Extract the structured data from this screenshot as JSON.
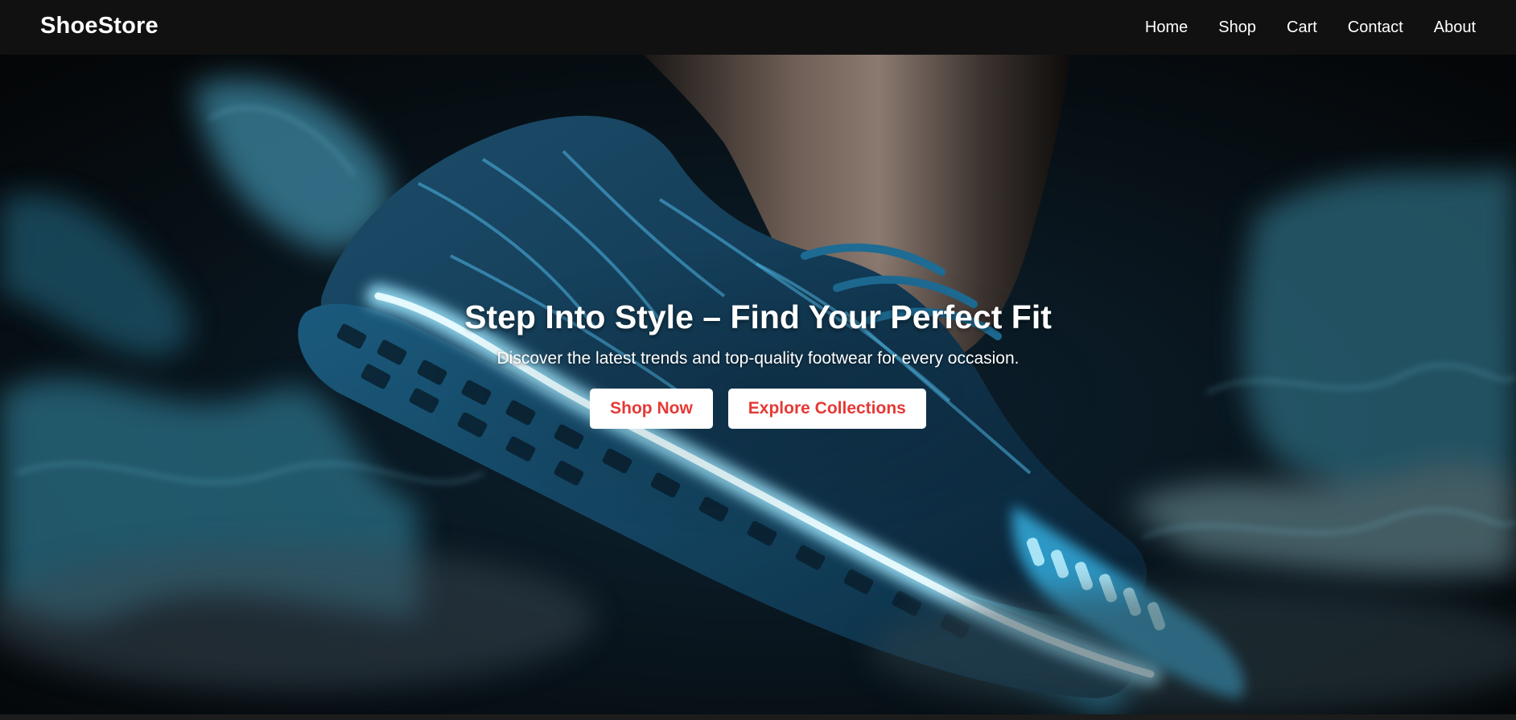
{
  "brand": {
    "name": "ShoeStore"
  },
  "nav": {
    "items": [
      {
        "label": "Home"
      },
      {
        "label": "Shop"
      },
      {
        "label": "Cart"
      },
      {
        "label": "Contact"
      },
      {
        "label": "About"
      }
    ]
  },
  "hero": {
    "title": "Step Into Style – Find Your Perfect Fit",
    "subtitle": "Discover the latest trends and top-quality footwear for every occasion.",
    "primary_button": "Shop Now",
    "secondary_button": "Explore Collections",
    "image": "glowing-sneaker-with-blue-smoke"
  },
  "colors": {
    "navbar_bg": "#111111",
    "accent": "#e53935",
    "button_bg": "#ffffff",
    "glow": "#2fc6ff"
  }
}
